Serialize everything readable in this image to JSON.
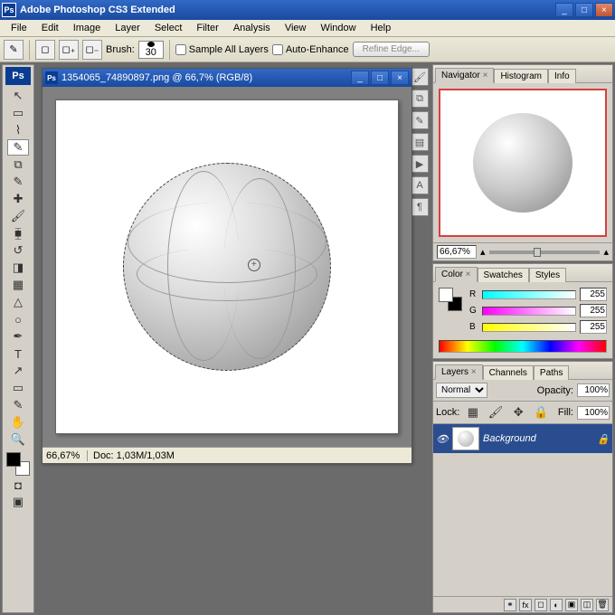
{
  "app_title": "Adobe Photoshop CS3 Extended",
  "menu": [
    "File",
    "Edit",
    "Image",
    "Layer",
    "Select",
    "Filter",
    "Analysis",
    "View",
    "Window",
    "Help"
  ],
  "options": {
    "brush_label": "Brush:",
    "brush_size": "30",
    "sample_all": "Sample All Layers",
    "auto_enhance": "Auto-Enhance",
    "refine": "Refine Edge..."
  },
  "doc": {
    "title": "1354065_74890897.png @ 66,7% (RGB/8)",
    "zoom": "66,67%",
    "size": "Doc: 1,03M/1,03M"
  },
  "navigator": {
    "tabs": [
      "Navigator",
      "Histogram",
      "Info"
    ],
    "zoom": "66,67%"
  },
  "color": {
    "tabs": [
      "Color",
      "Swatches",
      "Styles"
    ],
    "r_lbl": "R",
    "g_lbl": "G",
    "b_lbl": "B",
    "r": "255",
    "g": "255",
    "b": "255"
  },
  "layers": {
    "tabs": [
      "Layers",
      "Channels",
      "Paths"
    ],
    "blend": "Normal",
    "opacity_lbl": "Opacity:",
    "opacity": "100%",
    "lock_lbl": "Lock:",
    "fill_lbl": "Fill:",
    "fill": "100%",
    "name": "Background"
  }
}
